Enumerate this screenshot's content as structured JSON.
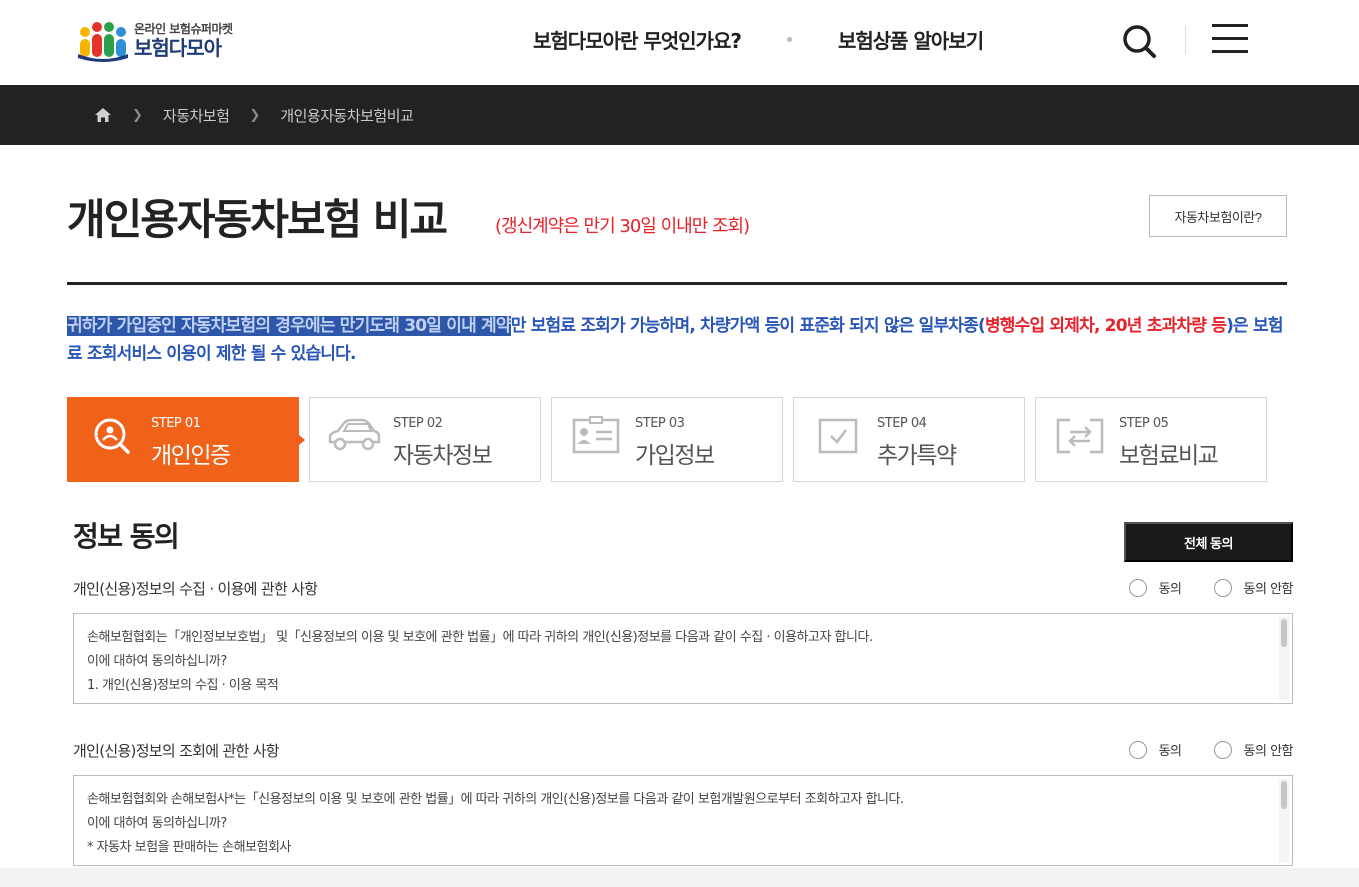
{
  "header": {
    "logo_sub": "온라인 보험슈퍼마켓",
    "logo_main": "보험다모아",
    "nav": [
      "보험다모아란 무엇인가요?",
      "보험상품 알아보기"
    ],
    "icons": [
      "search-icon",
      "hamburger-menu-icon"
    ]
  },
  "breadcrumb": {
    "items": [
      "자동차보험",
      "개인용자동차보험비교"
    ]
  },
  "page": {
    "title": "개인용자동차보험 비교",
    "subtitle": "(갱신계약은 만기 30일 이내만 조회)",
    "what_button": "자동차보험이란?"
  },
  "notice": {
    "highlighted": "귀하가 가입중인 자동차보험의 경우에는 만기도래 30일 이내 계약",
    "part1": "만 보험료 조회가 가능하며, 차량가액 등이 표준화 되지 않은 일부차종(",
    "red": "병행수입 외제차, 20년 초과차량 등",
    "part2": ")은 보험료 조회서비스 이용이 제한 될 수 있습니다."
  },
  "steps": [
    {
      "num": "STEP 01",
      "name": "개인인증",
      "icon": "search-person-icon",
      "active": true
    },
    {
      "num": "STEP 02",
      "name": "자동차정보",
      "icon": "car-icon",
      "active": false
    },
    {
      "num": "STEP 03",
      "name": "가입정보",
      "icon": "id-card-icon",
      "active": false
    },
    {
      "num": "STEP 04",
      "name": "추가특약",
      "icon": "checkbox-icon",
      "active": false
    },
    {
      "num": "STEP 05",
      "name": "보험료비교",
      "icon": "exchange-icon",
      "active": false
    }
  ],
  "agreement": {
    "title": "정보 동의",
    "agree_all": "전체 동의",
    "sections": [
      {
        "label": "개인(신용)정보의 수집 · 이용에 관한 사항",
        "agree": "동의",
        "disagree": "동의 안함",
        "lines": [
          "손해보험협회는「개인정보보호법」 및「신용정보의 이용 및 보호에 관한 법률」에 따라 귀하의 개인(신용)정보를 다음과 같이 수집 · 이용하고자 합니다.",
          "이에 대하여 동의하십니까?",
          "1. 개인(신용)정보의 수집 · 이용 목적"
        ]
      },
      {
        "label": "개인(신용)정보의 조회에 관한 사항",
        "agree": "동의",
        "disagree": "동의 안함",
        "lines": [
          "손해보험협회와 손해보험사*는「신용정보의 이용 및 보호에 관한 법률」에 따라 귀하의 개인(신용)정보를 다음과 같이 보험개발원으로부터 조회하고자 합니다.",
          "이에 대하여 동의하십니까?",
          "* 자동차 보험을 판매하는 손해보험회사"
        ]
      }
    ]
  },
  "colors": {
    "accent": "#f0611a",
    "dark_bar": "#222222",
    "notice_blue": "#2a56b8",
    "notice_red": "#e8212b"
  }
}
